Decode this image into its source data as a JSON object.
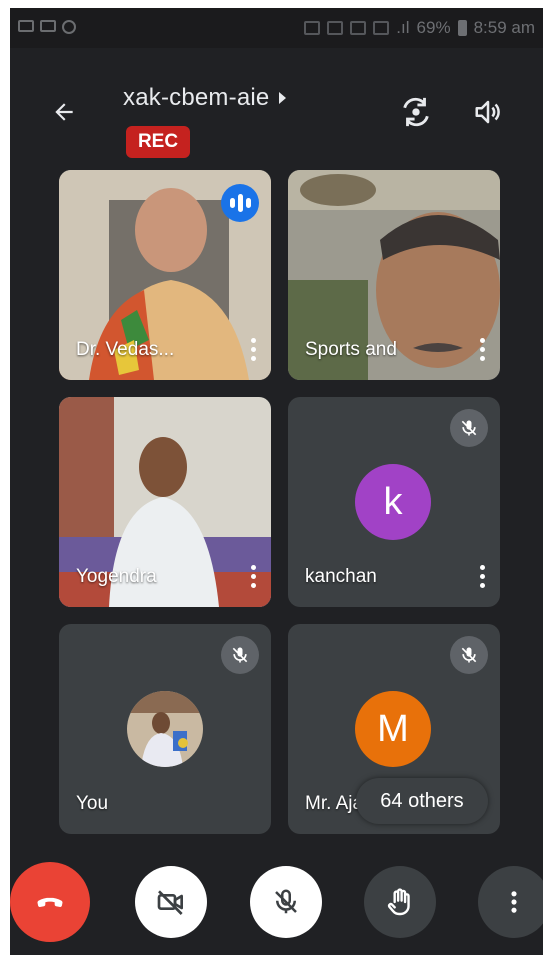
{
  "status_bar": {
    "battery": "69%",
    "time": "8:59 am",
    "signal": ".ıl"
  },
  "header": {
    "meeting_code": "xak-cbem-aie",
    "rec_label": "REC"
  },
  "participants": [
    {
      "name": "Dr. Vedas...",
      "speaking": true
    },
    {
      "name": "Sports and"
    },
    {
      "name": "Yogendra"
    },
    {
      "name": "kanchan",
      "initial": "k",
      "avatar_color": "#a142c6",
      "muted": true
    },
    {
      "name": "You",
      "muted": true
    },
    {
      "name": "Mr. Ajay Adhikari",
      "initial": "M",
      "avatar_color": "#e8710a",
      "muted": true
    }
  ],
  "others_label": "64 others",
  "colors": {
    "background": "#202124",
    "tile": "#3c4043",
    "end_call": "#ea4335",
    "rec": "#c5221f",
    "speaking": "#1a73e8"
  },
  "icons": {
    "back": "arrow-left-icon",
    "switch_camera": "camera-switch-icon",
    "speaker": "speaker-icon",
    "end_call": "phone-hangup-icon",
    "camera_off": "video-off-icon",
    "mic_off": "mic-off-icon",
    "raise_hand": "hand-icon",
    "more": "more-vertical-icon"
  }
}
